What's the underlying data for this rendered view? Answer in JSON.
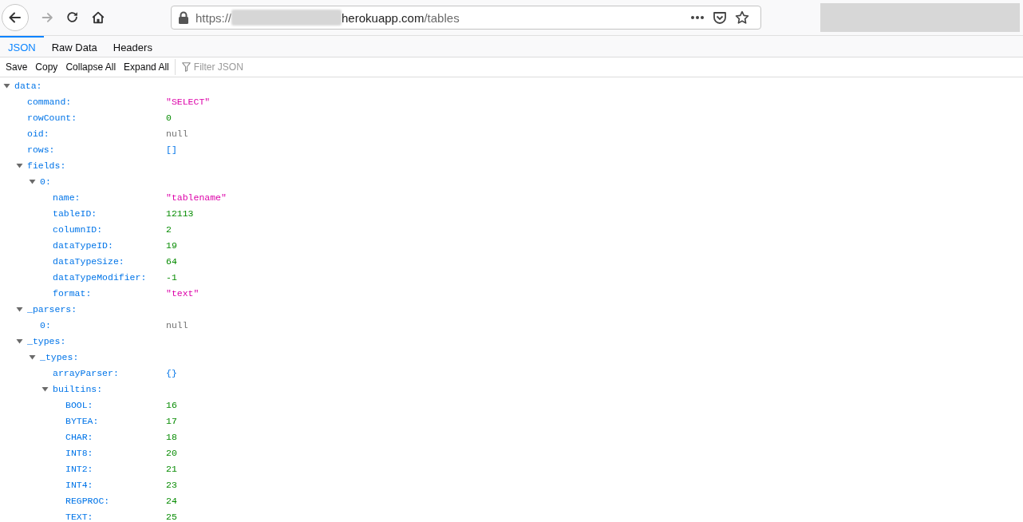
{
  "address_bar": {
    "scheme": "https://",
    "host": "herokuapp.com",
    "path": "/tables"
  },
  "tabs": [
    {
      "label": "JSON",
      "selected": true
    },
    {
      "label": "Raw Data",
      "selected": false
    },
    {
      "label": "Headers",
      "selected": false
    }
  ],
  "toolbar": {
    "buttons": [
      "Save",
      "Copy",
      "Collapse All",
      "Expand All"
    ],
    "filter": {
      "placeholder": "Filter JSON"
    }
  },
  "tree": [
    {
      "key": "data:",
      "expanded": true,
      "children": [
        {
          "key": "command:",
          "value": "\"SELECT\"",
          "kind": "string"
        },
        {
          "key": "rowCount:",
          "value": "0",
          "kind": "number"
        },
        {
          "key": "oid:",
          "value": "null",
          "kind": "null"
        },
        {
          "key": "rows:",
          "value": "[]",
          "kind": "empty"
        },
        {
          "key": "fields:",
          "expanded": true,
          "children": [
            {
              "key": "0:",
              "expanded": true,
              "children": [
                {
                  "key": "name:",
                  "value": "\"tablename\"",
                  "kind": "string"
                },
                {
                  "key": "tableID:",
                  "value": "12113",
                  "kind": "number"
                },
                {
                  "key": "columnID:",
                  "value": "2",
                  "kind": "number"
                },
                {
                  "key": "dataTypeID:",
                  "value": "19",
                  "kind": "number"
                },
                {
                  "key": "dataTypeSize:",
                  "value": "64",
                  "kind": "number"
                },
                {
                  "key": "dataTypeModifier:",
                  "value": "-1",
                  "kind": "number"
                },
                {
                  "key": "format:",
                  "value": "\"text\"",
                  "kind": "string"
                }
              ]
            }
          ]
        },
        {
          "key": "_parsers:",
          "expanded": true,
          "children": [
            {
              "key": "0:",
              "value": "null",
              "kind": "null"
            }
          ]
        },
        {
          "key": "_types:",
          "expanded": true,
          "children": [
            {
              "key": "_types:",
              "expanded": true,
              "children": [
                {
                  "key": "arrayParser:",
                  "value": "{}",
                  "kind": "empty"
                },
                {
                  "key": "builtins:",
                  "expanded": true,
                  "children": [
                    {
                      "key": "BOOL:",
                      "value": "16",
                      "kind": "number"
                    },
                    {
                      "key": "BYTEA:",
                      "value": "17",
                      "kind": "number"
                    },
                    {
                      "key": "CHAR:",
                      "value": "18",
                      "kind": "number"
                    },
                    {
                      "key": "INT8:",
                      "value": "20",
                      "kind": "number"
                    },
                    {
                      "key": "INT2:",
                      "value": "21",
                      "kind": "number"
                    },
                    {
                      "key": "INT4:",
                      "value": "23",
                      "kind": "number"
                    },
                    {
                      "key": "REGPROC:",
                      "value": "24",
                      "kind": "number"
                    },
                    {
                      "key": "TEXT:",
                      "value": "25",
                      "kind": "number"
                    }
                  ]
                }
              ]
            }
          ]
        }
      ]
    }
  ]
}
